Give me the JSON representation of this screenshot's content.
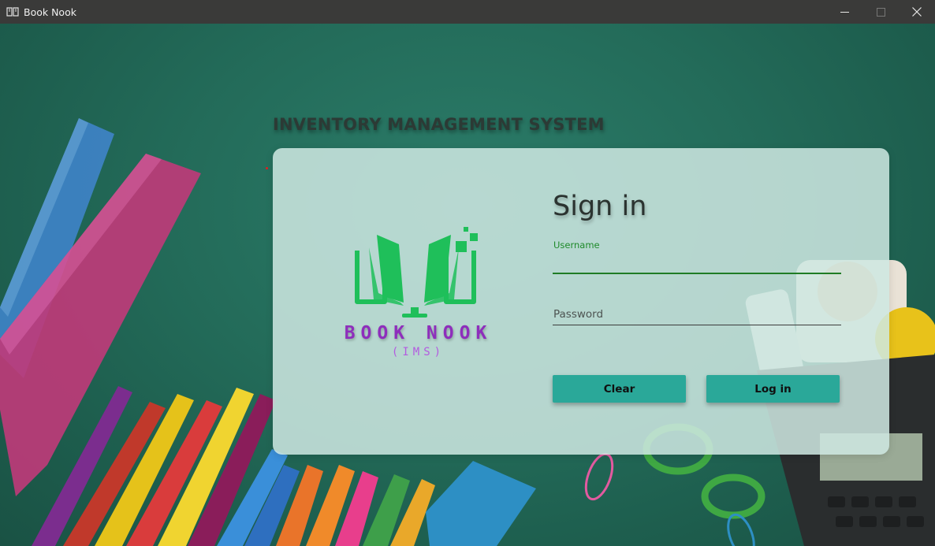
{
  "window": {
    "title": "Book Nook",
    "app_icon": "book-icon",
    "controls": [
      "minimize-icon",
      "maximize-icon",
      "close-icon"
    ]
  },
  "page": {
    "heading": "INVENTORY MANAGEMENT SYSTEM"
  },
  "brand": {
    "name": "BOOK NOOK",
    "subtitle": "(IMS)",
    "logo_icon": "open-book-monitor-icon",
    "colors": {
      "logo": "#1fbf5a",
      "name": "#8e2ebc",
      "subtitle": "#b35ae0"
    }
  },
  "form": {
    "title": "Sign in",
    "username": {
      "label": "Username",
      "value": ""
    },
    "password": {
      "placeholder": "Password",
      "value": ""
    },
    "clear_label": "Clear",
    "login_label": "Log in"
  },
  "colors": {
    "background": "#236b59",
    "button": "#2aa899",
    "focus_underline": "#1f7c25"
  }
}
